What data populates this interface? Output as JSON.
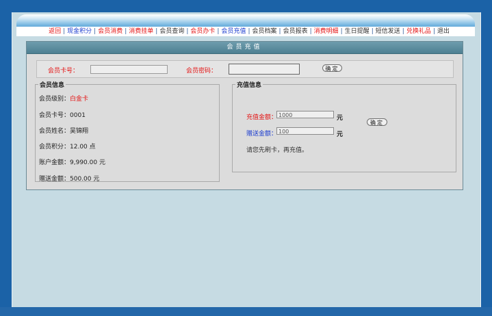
{
  "nav": {
    "items": [
      {
        "label": "返回",
        "color": "#e41515"
      },
      {
        "label": "现金积分",
        "color": "#1b3ccf"
      },
      {
        "label": "会员消费",
        "color": "#e41515"
      },
      {
        "label": "消费挂单",
        "color": "#e41515"
      },
      {
        "label": "会员查询",
        "color": "#333333"
      },
      {
        "label": "会员办卡",
        "color": "#e41515"
      },
      {
        "label": "会员充值",
        "color": "#1b3ccf"
      },
      {
        "label": "会员档案",
        "color": "#333333"
      },
      {
        "label": "会员报表",
        "color": "#333333"
      },
      {
        "label": "消费明细",
        "color": "#e41515"
      },
      {
        "label": "生日提醒",
        "color": "#333333"
      },
      {
        "label": "短信发送",
        "color": "#333333"
      },
      {
        "label": "兑换礼品",
        "color": "#e41515"
      },
      {
        "label": "退出",
        "color": "#333333"
      }
    ],
    "separator": "|"
  },
  "panel": {
    "title": "会员充值"
  },
  "login": {
    "card_label": "会员卡号：",
    "password_label": "会员密码：",
    "card_value": "",
    "password_value": "",
    "confirm_label": "确定"
  },
  "member_info": {
    "legend": "会员信息",
    "level_label": "会员级别：",
    "level_value": "白金卡",
    "card_no_label": "会员卡号：",
    "card_no_value": "0001",
    "name_label": "会员姓名：",
    "name_value": "吴锦翔",
    "points_label": "会员积分：",
    "points_value": "12.00",
    "points_unit": "点",
    "balance_label": "账户金额：",
    "balance_value": "9,990.00",
    "balance_unit": "元",
    "gift_label": "赠送金额：",
    "gift_value": "500.00",
    "gift_unit": "元"
  },
  "recharge_info": {
    "legend": "充值信息",
    "amount_label": "充值金额：",
    "amount_value": "1000",
    "amount_unit": "元",
    "bonus_label": "赠送金额：",
    "bonus_value": "100",
    "bonus_unit": "元",
    "confirm_label": "确定",
    "hint": "请您先刷卡，再充值。"
  },
  "colors": {
    "frame": "#1b62a7",
    "content_bg": "#c6dbe3",
    "panel_bg": "#dcdcdc",
    "title_bar": "#5a8a9c",
    "red": "#e41515",
    "blue": "#1b3ccf"
  }
}
